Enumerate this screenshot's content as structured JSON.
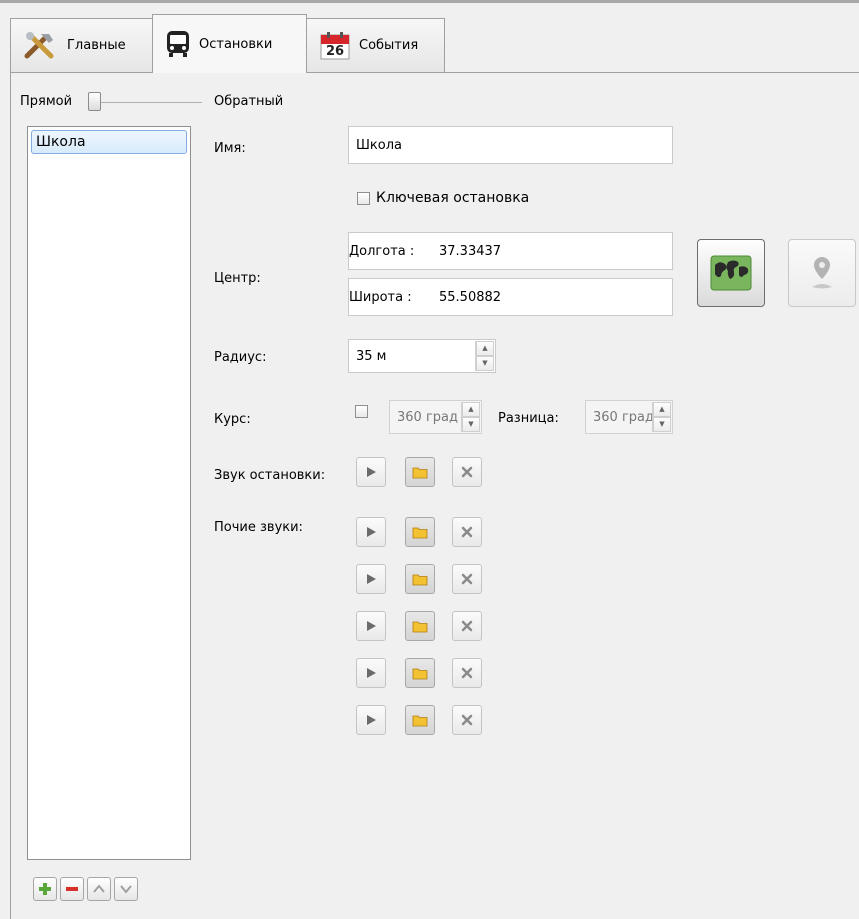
{
  "tabs": [
    {
      "label": "Главные",
      "icon": "tools-icon"
    },
    {
      "label": "Остановки",
      "icon": "bus-icon"
    },
    {
      "label": "События",
      "icon": "calendar-icon",
      "calendar_day": "26"
    }
  ],
  "direction": {
    "left_label": "Прямой",
    "right_label": "Обратный",
    "value": 0
  },
  "stops": [
    "Школа"
  ],
  "form": {
    "name_label": "Имя:",
    "name_value": "Школа",
    "key_stop_label": "Ключевая остановка",
    "key_stop_checked": false,
    "center_label": "Центр:",
    "longitude_label": "Долгота :",
    "longitude_value": "37.33437",
    "latitude_label": "Широта  :",
    "latitude_value": "55.50882",
    "radius_label": "Радиус:",
    "radius_value": "35 м",
    "course_label": "Курс:",
    "course_checked": false,
    "course_value": "360 град",
    "diff_label": "Разница:",
    "diff_value": "360 град",
    "stop_sound_label": "Звук остановки:",
    "other_sounds_label": "Почие звуки:",
    "other_sounds_count": 5
  },
  "colors": {
    "map_button": "#7ab65d",
    "folder": "#f2c232",
    "selection": "#d8ebfb",
    "remove": "#d9302a",
    "add": "#5aa83a"
  }
}
